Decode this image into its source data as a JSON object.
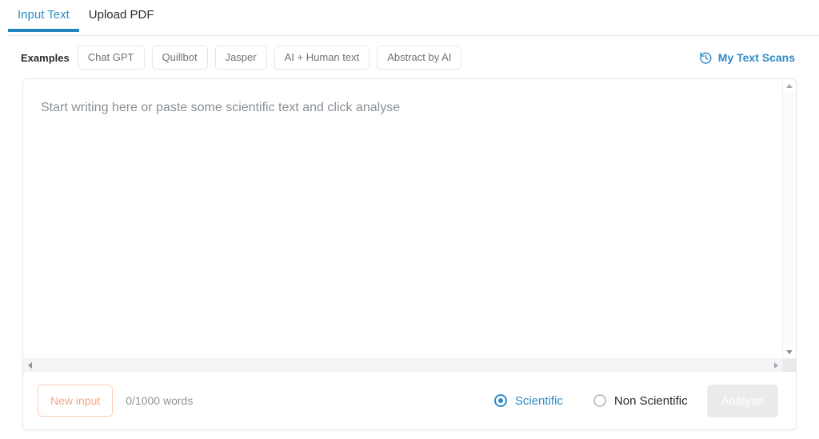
{
  "tabs": [
    {
      "label": "Input Text",
      "active": true
    },
    {
      "label": "Upload PDF",
      "active": false
    }
  ],
  "examples": {
    "label": "Examples",
    "chips": [
      "Chat GPT",
      "Quillbot",
      "Jasper",
      "AI + Human text",
      "Abstract by AI"
    ]
  },
  "scans_link": {
    "label": "My Text Scans",
    "icon": "history-icon"
  },
  "editor": {
    "placeholder": "Start writing here or paste some scientific text and click analyse",
    "value": ""
  },
  "footer": {
    "new_input_label": "New input",
    "word_count": "0/1000 words",
    "radios": [
      {
        "label": "Scientific",
        "checked": true
      },
      {
        "label": "Non Scientific",
        "checked": false
      }
    ],
    "analyse_label": "Analyse"
  },
  "colors": {
    "accent_blue": "#2e8bc6",
    "tab_underline": "#2386c3",
    "new_input_orange": "#f8a882",
    "new_input_border": "#fbcdb8",
    "disabled_button_bg": "#e9ebed",
    "placeholder_gray": "#8a9096",
    "border_gray": "#e6e8ea"
  }
}
